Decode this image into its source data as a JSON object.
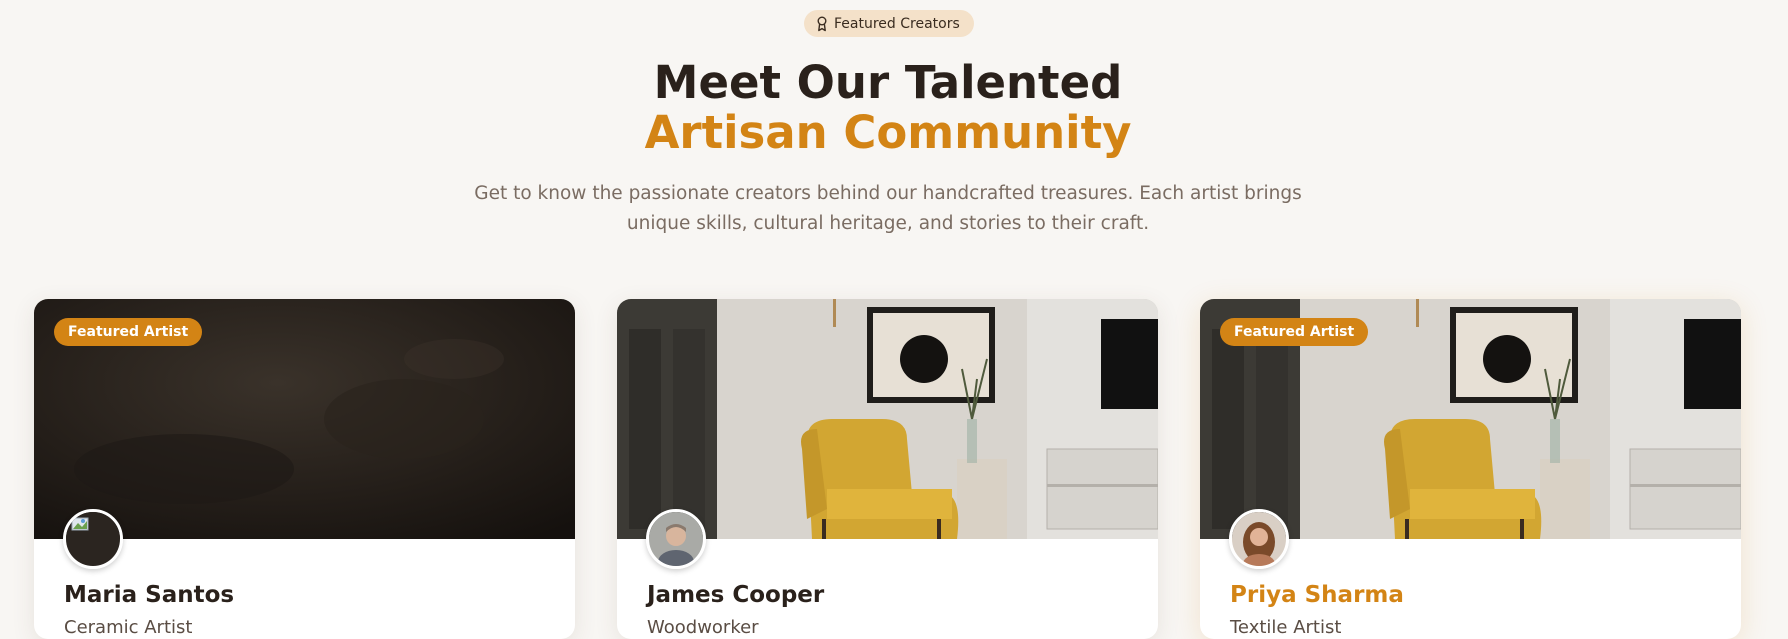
{
  "header": {
    "badge_label": "Featured Creators",
    "badge_icon": "award-icon",
    "title_line1": "Meet Our Talented",
    "title_line2": "Artisan Community",
    "subtitle": "Get to know the passionate creators behind our handcrafted treasures. Each artist brings unique skills, cultural heritage, and stories to their craft."
  },
  "colors": {
    "accent": "#d38415",
    "heading": "#2a211b",
    "muted": "#7a6c62",
    "badge_bg": "#f4e1c9"
  },
  "artists": [
    {
      "name": "Maria Santos",
      "role": "Ceramic Artist",
      "featured_label": "Featured Artist",
      "banner": "dark-texture",
      "avatar": "broken-image"
    },
    {
      "name": "James Cooper",
      "role": "Woodworker",
      "featured_label": "",
      "banner": "interior-yellow-chair",
      "avatar": "portrait-man"
    },
    {
      "name": "Priya Sharma",
      "role": "Textile Artist",
      "featured_label": "Featured Artist",
      "banner": "interior-yellow-chair",
      "avatar": "portrait-woman"
    }
  ]
}
